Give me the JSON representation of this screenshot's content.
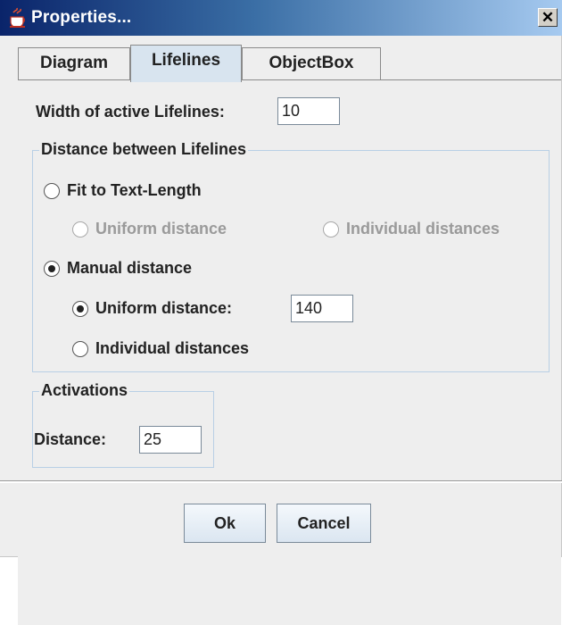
{
  "window": {
    "title": "Properties...",
    "close_glyph": "✕"
  },
  "tabs": [
    {
      "label": "Diagram",
      "active": false
    },
    {
      "label": "Lifelines",
      "active": true
    },
    {
      "label": "ObjectBox",
      "active": false
    }
  ],
  "lifelines": {
    "width_label": "Width of active Lifelines:",
    "width_value": "10"
  },
  "distance_group": {
    "title": "Distance between Lifelines",
    "fit_to_text": {
      "label": "Fit to Text-Length",
      "selected": false
    },
    "fit_uniform": {
      "label": "Uniform distance",
      "selected": false,
      "enabled": false
    },
    "fit_individual": {
      "label": "Individual distances",
      "selected": false,
      "enabled": false
    },
    "manual": {
      "label": "Manual distance",
      "selected": true
    },
    "manual_uniform": {
      "label": "Uniform distance:",
      "selected": true,
      "value": "140"
    },
    "manual_individual": {
      "label": "Individual distances",
      "selected": false
    }
  },
  "activations_group": {
    "title": "Activations",
    "distance_label": "Distance:",
    "distance_value": "25"
  },
  "buttons": {
    "ok": "Ok",
    "cancel": "Cancel"
  },
  "icons": {
    "title_icon": "java-cup-icon",
    "close_icon": "close-icon"
  },
  "colors": {
    "titlebar_start": "#0a246a",
    "titlebar_end": "#a6caf0",
    "group_border": "#b8cfe5",
    "active_tab": "#d8e4ef"
  }
}
